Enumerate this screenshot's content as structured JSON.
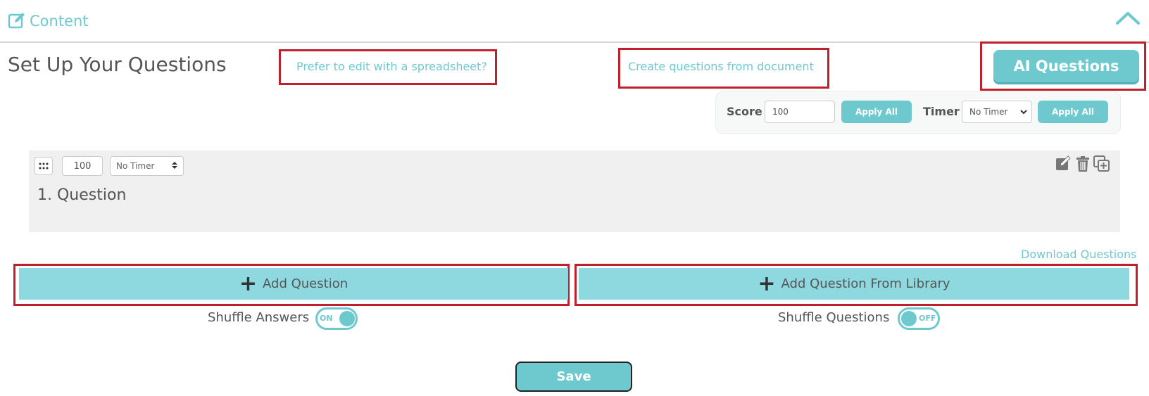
{
  "header": {
    "section_label": "Content",
    "section_icon": "edit-square-icon",
    "collapse_icon": "chevron-up-icon"
  },
  "page": {
    "title": "Set Up Your Questions",
    "spreadsheet_link": "Prefer to edit with a spreadsheet?",
    "document_link": "Create questions from document",
    "ai_button": "AI Questions"
  },
  "bulk_settings": {
    "score_label": "Score",
    "score_value": "100",
    "apply_score_label": "Apply All",
    "timer_label": "Timer",
    "timer_value": "No Timer",
    "apply_timer_label": "Apply All"
  },
  "question": {
    "score_value": "100",
    "timer_value": "No Timer",
    "text": "1. Question",
    "icons": [
      "edit-icon",
      "trash-icon",
      "duplicate-icon"
    ]
  },
  "actions": {
    "download_link": "Download Questions",
    "add_question": "Add Question",
    "add_from_library": "Add Question From Library"
  },
  "shuffle": {
    "answers_label": "Shuffle Answers",
    "answers_state": "ON",
    "questions_label": "Shuffle Questions",
    "questions_state": "OFF"
  },
  "footer": {
    "save_label": "Save"
  },
  "colors": {
    "accent": "#6ec9cf",
    "accent_light": "#8ed9df",
    "highlight": "#c0202b",
    "text": "#555555"
  }
}
